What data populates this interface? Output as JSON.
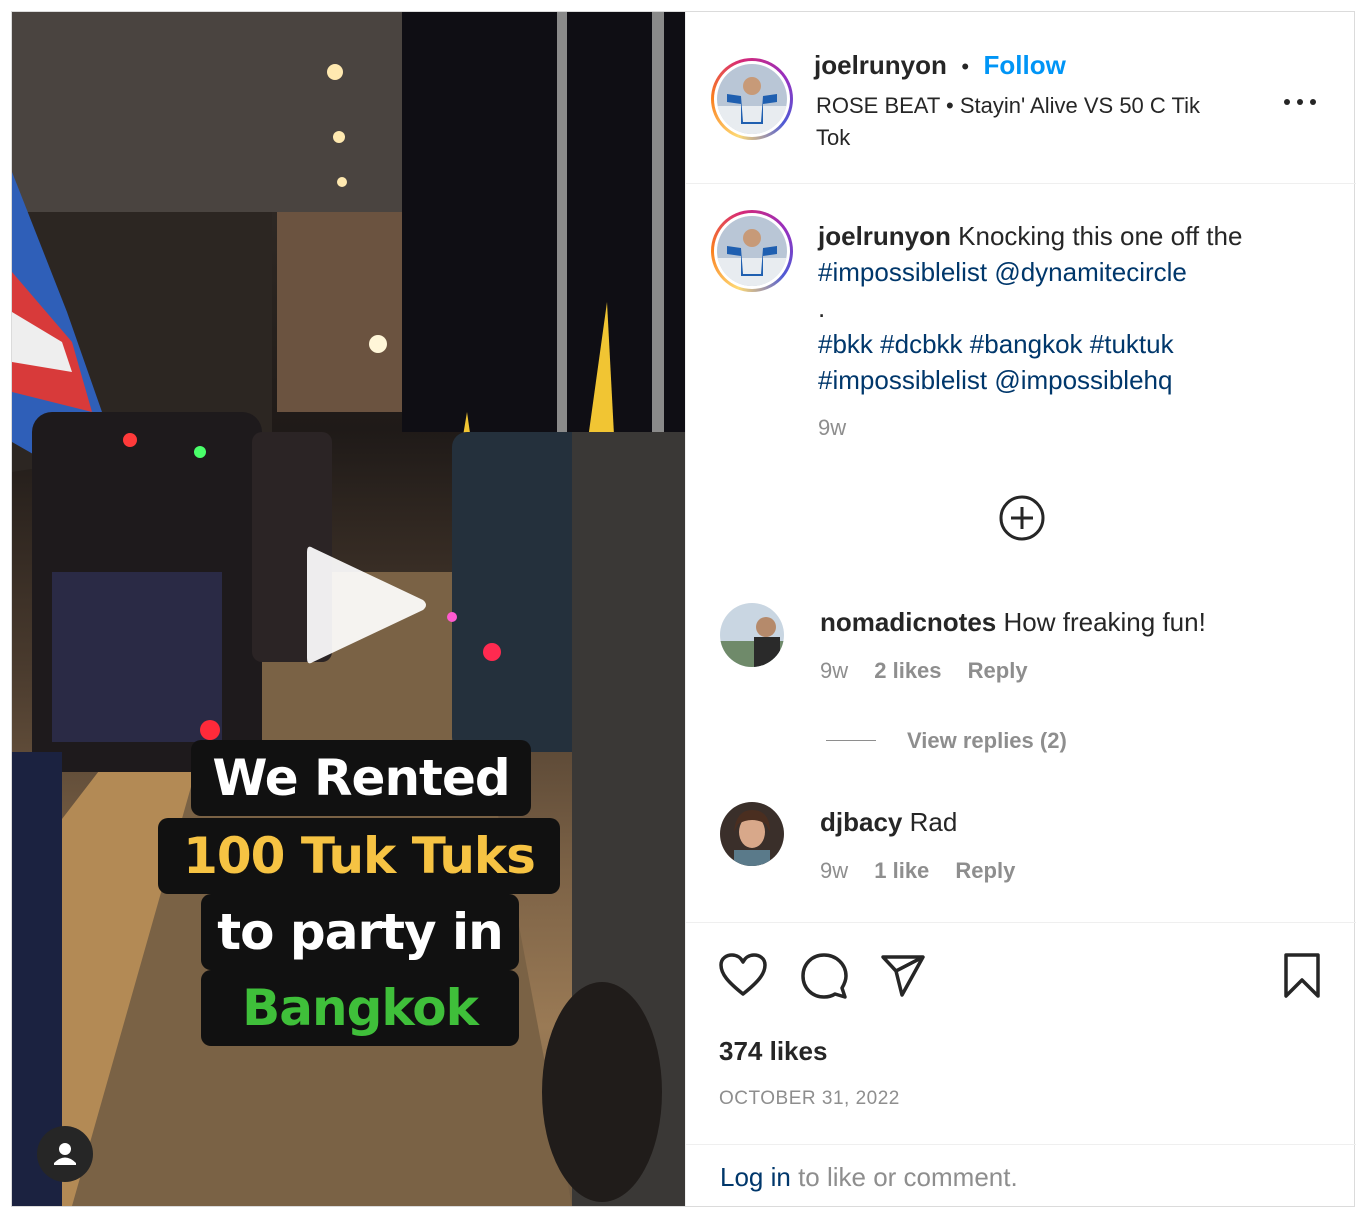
{
  "post": {
    "media": {
      "caption_lines": [
        "We Rented",
        "100 Tuk Tuks",
        "to party in",
        "Bangkok"
      ],
      "caption_colors": [
        "#ffffff",
        "#f6c343",
        "#ffffff",
        "#3fbf3a"
      ]
    },
    "header": {
      "username": "joelrunyon",
      "separator": "•",
      "follow_label": "Follow",
      "audio": "ROSE BEAT • Stayin' Alive VS 50 C Tik Tok"
    },
    "caption": {
      "username": "joelrunyon",
      "text": "Knocking this one off the",
      "tags_line1": [
        "#impossiblelist",
        "@dynamitecircle"
      ],
      "dot": ".",
      "tags_line2": [
        "#bkk",
        "#dcbkk",
        "#bangkok",
        "#tuktuk"
      ],
      "tags_line3": [
        "#impossiblelist",
        "@impossiblehq"
      ],
      "time": "9w"
    },
    "comments": [
      {
        "username": "nomadicnotes",
        "text": "How freaking fun!",
        "time": "9w",
        "likes": "2 likes",
        "reply": "Reply",
        "view_replies": "View replies (2)"
      },
      {
        "username": "djbacy",
        "text": "Rad",
        "time": "9w",
        "likes": "1 like",
        "reply": "Reply"
      }
    ],
    "likes": "374 likes",
    "date": "OCTOBER 31, 2022",
    "login": {
      "link": "Log in",
      "rest": " to like or comment."
    },
    "icons": [
      "play-icon",
      "user-tag-icon",
      "more-icon",
      "add-comment-icon",
      "heart-icon",
      "comment-icon",
      "share-icon",
      "bookmark-icon"
    ],
    "colors": {
      "link": "#0095f6",
      "tag": "#00376b",
      "muted": "#8e8e8e"
    }
  }
}
